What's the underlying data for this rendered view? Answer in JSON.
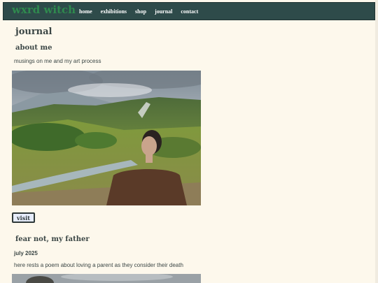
{
  "site": {
    "brand": "wxrd witch"
  },
  "nav": {
    "items": [
      {
        "label": "home"
      },
      {
        "label": "exhibitions"
      },
      {
        "label": "shop"
      },
      {
        "label": "journal"
      },
      {
        "label": "contact"
      }
    ]
  },
  "page": {
    "title": "journal"
  },
  "entries": [
    {
      "title": "about me",
      "description": "musings on me and my art process",
      "button_label": "visit"
    },
    {
      "title": "fear not, my father",
      "date": "july 2025",
      "description": "here rests a poem about loving a parent as they consider their death"
    }
  ],
  "colors": {
    "nav_bg": "#2e4b4a",
    "brand": "#2f8a4e",
    "page_bg": "#fdf8ec",
    "text": "#3b4645",
    "button_bg": "#e6ecfb"
  }
}
